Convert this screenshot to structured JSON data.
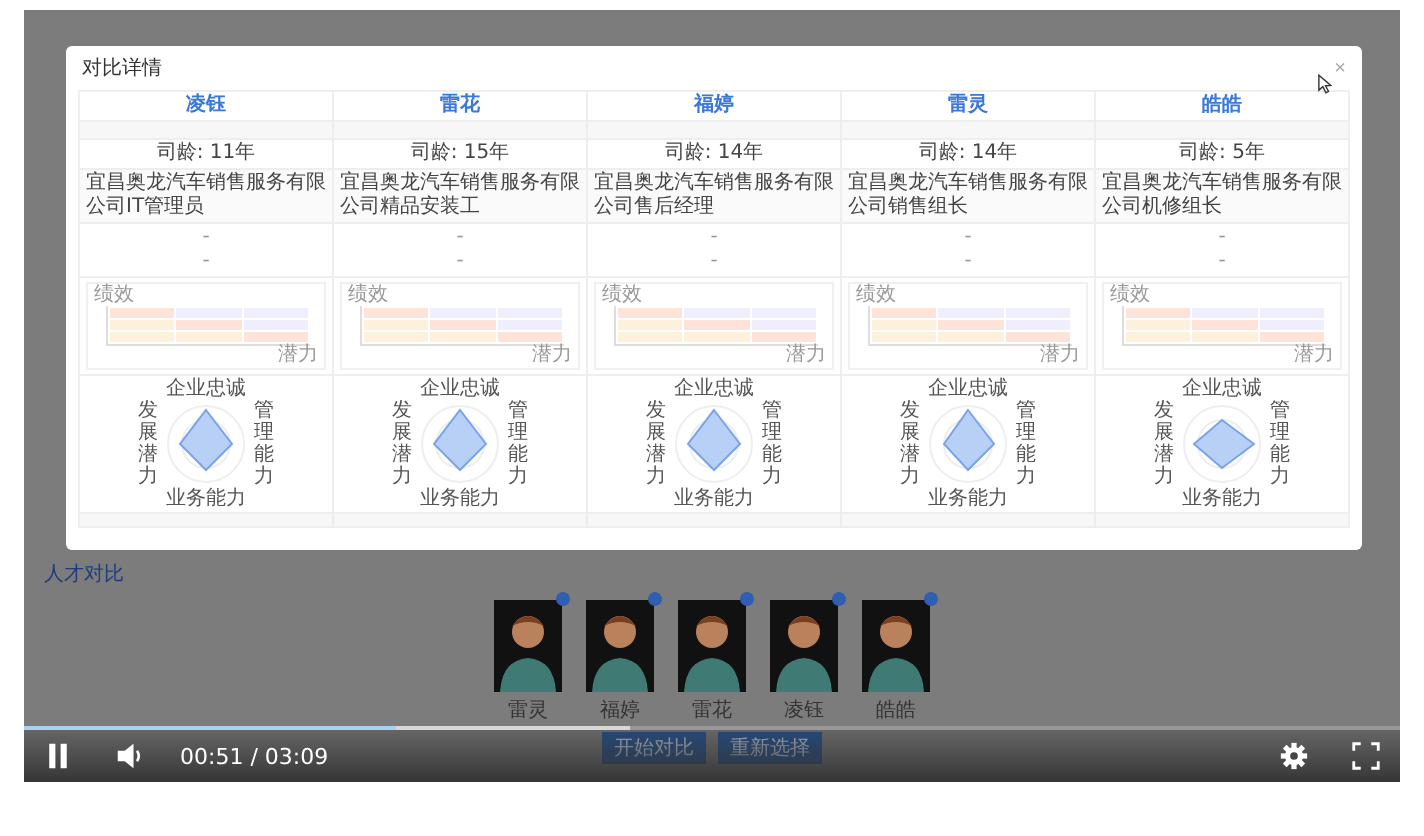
{
  "page": {
    "section_title": "人才对比",
    "candidates": [
      {
        "name": "雷灵"
      },
      {
        "name": "福婷"
      },
      {
        "name": "雷花"
      },
      {
        "name": "凌钰"
      },
      {
        "name": "皓皓"
      }
    ],
    "buttons": [
      "开始对比",
      "重新选择"
    ]
  },
  "modal": {
    "title": "对比详情",
    "close": "×",
    "columns": [
      {
        "name": "凌钰",
        "tenure": "司龄: 11年",
        "position": "宜昌奥龙汽车销售服务有限公司IT管理员",
        "details": [
          "-",
          "-"
        ],
        "grid_labels": {
          "y": "绩效",
          "x": "潜力"
        },
        "radar_labels": {
          "top": "企业忠诚",
          "right": "管理能力",
          "bottom": "业务能力",
          "left": "发展潜力"
        }
      },
      {
        "name": "雷花",
        "tenure": "司龄: 15年",
        "position": "宜昌奥龙汽车销售服务有限公司精品安装工",
        "details": [
          "-",
          "-"
        ],
        "grid_labels": {
          "y": "绩效",
          "x": "潜力"
        },
        "radar_labels": {
          "top": "企业忠诚",
          "right": "管理能力",
          "bottom": "业务能力",
          "left": "发展潜力"
        }
      },
      {
        "name": "福婷",
        "tenure": "司龄: 14年",
        "position": "宜昌奥龙汽车销售服务有限公司售后经理",
        "details": [
          "-",
          "-"
        ],
        "grid_labels": {
          "y": "绩效",
          "x": "潜力"
        },
        "radar_labels": {
          "top": "企业忠诚",
          "right": "管理能力",
          "bottom": "业务能力",
          "left": "发展潜力"
        }
      },
      {
        "name": "雷灵",
        "tenure": "司龄: 14年",
        "position": "宜昌奥龙汽车销售服务有限公司销售组长",
        "details": [
          "-",
          "-"
        ],
        "grid_labels": {
          "y": "绩效",
          "x": "潜力"
        },
        "radar_labels": {
          "top": "企业忠诚",
          "right": "管理能力",
          "bottom": "业务能力",
          "left": "发展潜力"
        }
      },
      {
        "name": "皓皓",
        "tenure": "司龄: 5年",
        "position": "宜昌奥龙汽车销售服务有限公司机修组长",
        "details": [
          "-",
          "-"
        ],
        "grid_labels": {
          "y": "绩效",
          "x": "潜力"
        },
        "radar_labels": {
          "top": "企业忠诚",
          "right": "管理能力",
          "bottom": "业务能力",
          "left": "发展潜力"
        }
      }
    ]
  },
  "player": {
    "level": 0.27,
    "time": "00:51 / 03:09"
  }
}
